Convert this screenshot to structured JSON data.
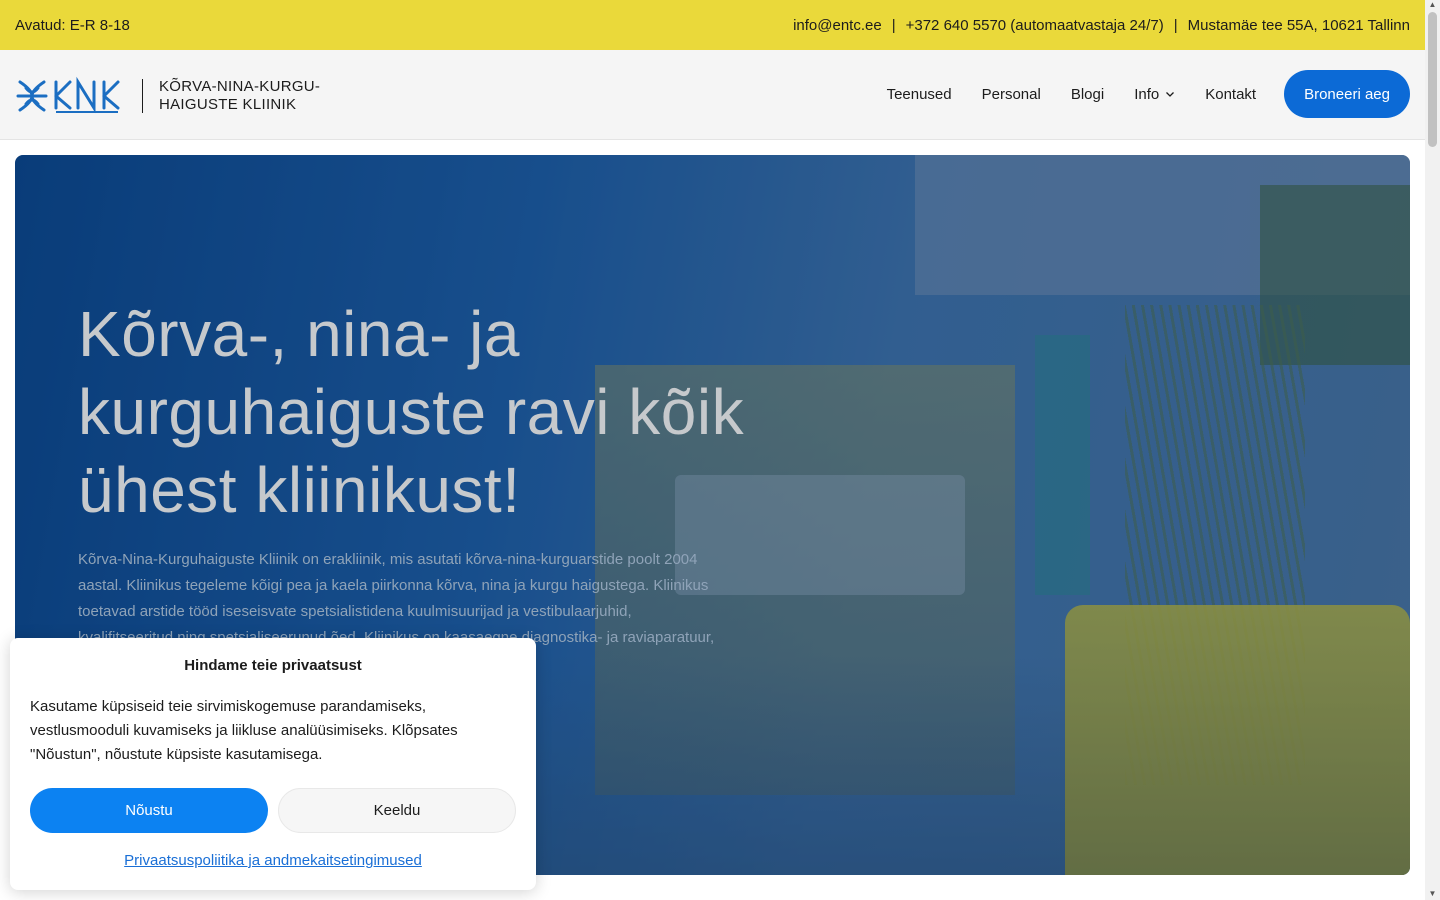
{
  "topbar": {
    "hours": "Avatud: E-R 8-18",
    "email": "info@entc.ee",
    "phone": "+372 640 5570 (automaatvastaja 24/7)",
    "address": "Mustamäe tee 55A, 10621 Tallinn",
    "separator": "|"
  },
  "header": {
    "logo_text_line1": "KÕRVA-NINA-KURGU-",
    "logo_text_line2": "HAIGUSTE KLIINIK",
    "nav": [
      {
        "label": "Teenused"
      },
      {
        "label": "Personal"
      },
      {
        "label": "Blogi"
      },
      {
        "label": "Info"
      },
      {
        "label": "Kontakt"
      }
    ],
    "cta_label": "Broneeri aeg"
  },
  "hero": {
    "heading": "Kõrva-, nina- ja kurguhaiguste ravi kõik ühest kliinikust!",
    "text": "Kõrva-Nina-Kurguhaiguste Kliinik on erakliinik, mis asutati kõrva-nina-kurguarstide poolt 2004 aastal. Kliinikus tegeleme kõigi pea ja kaela piirkonna kõrva, nina ja kurgu haigustega. Kliinikus toetavad arstide tööd iseseisvate spetsialistidena kuulmisuurijad ja vestibulaarjuhid, kvalifitseeritud ning spetsialiseerunud õed. Kliinikus on kaasaegne diagnostika- ja raviaparatuur, sõbralik ja isikupärane lähenemine ning nüüdisaegsed"
  },
  "cookie": {
    "title": "Hindame teie privaatsust",
    "body": "Kasutame küpsiseid teie sirvimiskogemuse parandamiseks, vestlusmooduli kuvamiseks ja liikluse analüüsimiseks. Klõpsates \"Nõustun\", nõustute küpsiste kasutamisega.",
    "accept_label": "Nõustu",
    "deny_label": "Keeldu",
    "policy_link": "Privaatsuspoliitika ja andmekaitsetingimused"
  },
  "colors": {
    "topbar_bg": "#ead93a",
    "accent": "#0c6ad6",
    "cookie_accept": "#0c82f2",
    "link": "#1a6fd6"
  }
}
